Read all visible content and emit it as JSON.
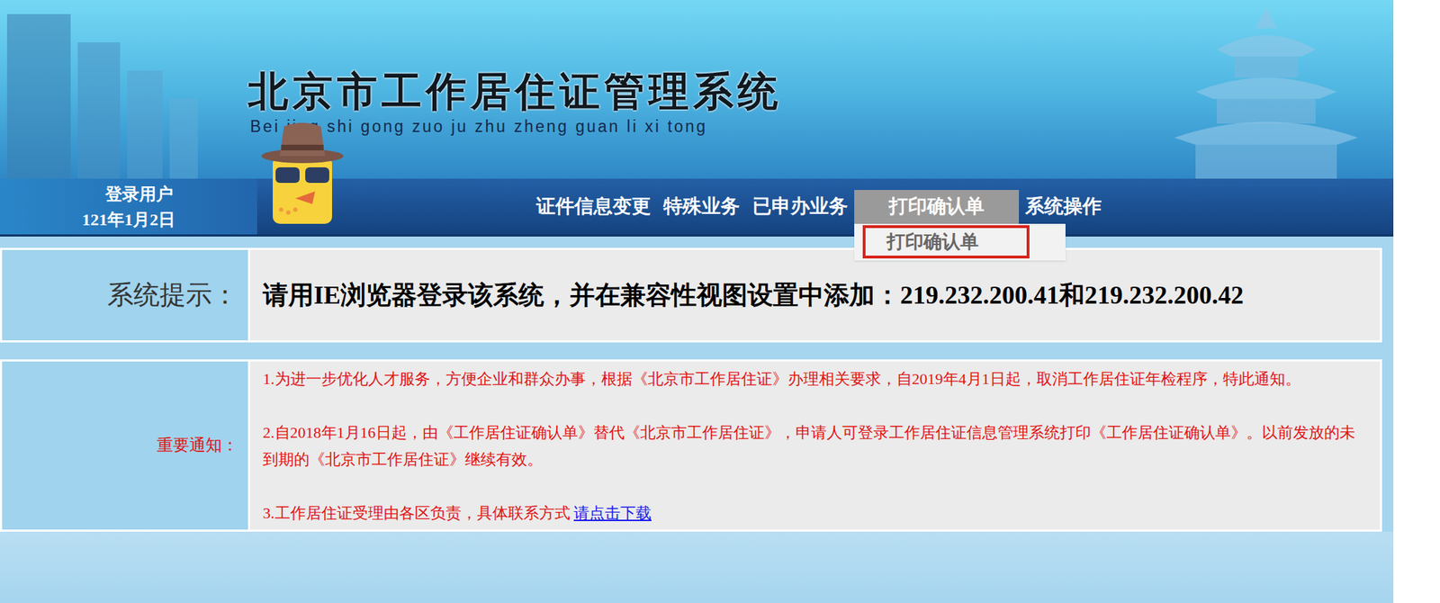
{
  "header": {
    "title": "北京市工作居住证管理系统",
    "subtitle": "Bei jing shi gong zuo ju zhu zheng guan li xi tong"
  },
  "user": {
    "label": "登录用户",
    "date": "121年1月2日"
  },
  "nav": [
    {
      "label": "证件信息变更",
      "selected": false
    },
    {
      "label": "特殊业务",
      "selected": false
    },
    {
      "label": "已申办业务",
      "selected": false
    },
    {
      "label": "打印确认单",
      "selected": true
    },
    {
      "label": "系统操作",
      "selected": false
    }
  ],
  "dropdown": [
    {
      "label": "打印确认单",
      "highlighted": true
    }
  ],
  "system_tip": {
    "label": "系统提示：",
    "text": "请用IE浏览器登录该系统，并在兼容性视图设置中添加：219.232.200.41和219.232.200.42"
  },
  "notice": {
    "label": "重要通知：",
    "items": [
      {
        "text": "1.为进一步优化人才服务，方便企业和群众办事，根据《北京市工作居住证》办理相关要求，自2019年4月1日起，取消工作居住证年检程序，特此通知。",
        "link": ""
      },
      {
        "text": "2.自2018年1月16日起，由《工作居住证确认单》替代《北京市工作居住证》，申请人可登录工作居住证信息管理系统打印《工作居住证确认单》。以前发放的未到期的《北京市工作居住证》继续有效。",
        "link": ""
      },
      {
        "text": "3.工作居住证受理由各区负责，具体联系方式 ",
        "link": "请点击下载"
      }
    ]
  }
}
